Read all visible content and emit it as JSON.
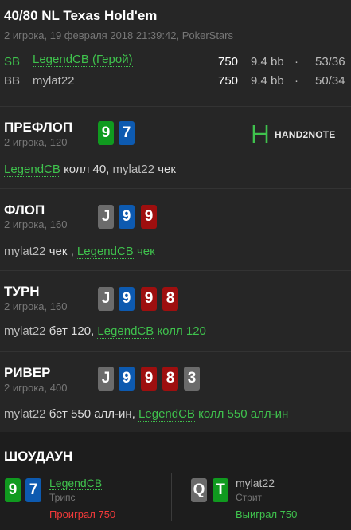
{
  "header": {
    "title": "40/80 NL Texas Hold'em",
    "subtitle": "2 игрока, 19 февраля 2018 21:39:42, PokerStars"
  },
  "players": [
    {
      "position": "SB",
      "name": "LegendCB (Герой)",
      "stack": "750",
      "bb": "9.4 bb",
      "dot": "·",
      "stats": "53/36"
    },
    {
      "position": "BB",
      "name": "mylat22",
      "stack": "750",
      "bb": "9.4 bb",
      "dot": "·",
      "stats": "50/34"
    }
  ],
  "logo": {
    "text": "HAND2NOTE"
  },
  "streets": {
    "preflop": {
      "title": "ПРЕФЛОП",
      "sub": "2 игрока, 120",
      "cards": [
        "9",
        "7"
      ],
      "actions": {
        "p1": "LegendCB",
        "a1": " колл 40, ",
        "p2": "mylat22",
        "a2": " чек"
      }
    },
    "flop": {
      "title": "ФЛОП",
      "sub": "2 игрока, 160",
      "cards": [
        "J",
        "9",
        "9"
      ],
      "actions": {
        "p1": "mylat22",
        "a1": " чек , ",
        "p2": "LegendCB",
        "a2": " чек"
      }
    },
    "turn": {
      "title": "ТУРН",
      "sub": "2 игрока, 160",
      "cards": [
        "J",
        "9",
        "9",
        "8"
      ],
      "actions": {
        "p1": "mylat22",
        "a1": " бет 120, ",
        "p2": "LegendCB",
        "a2": " колл 120"
      }
    },
    "river": {
      "title": "РИВЕР",
      "sub": "2 игрока, 400",
      "cards": [
        "J",
        "9",
        "9",
        "8",
        "3"
      ],
      "actions": {
        "p1": "mylat22",
        "a1": " бет 550 алл-ин, ",
        "p2": "LegendCB",
        "a2": " колл 550 алл-ин"
      }
    }
  },
  "showdown": {
    "title": "ШОУДАУН",
    "left": {
      "cards": [
        "9",
        "7"
      ],
      "name": "LegendCB",
      "hand": "Трипс",
      "result": "Проиграл 750"
    },
    "right": {
      "cards": [
        "Q",
        "T"
      ],
      "name": "mylat22",
      "hand": "Стрит",
      "result": "Выиграл 750"
    }
  },
  "colors": {
    "green_card": "#109a1f",
    "blue_card": "#0d5ab0",
    "red_card": "#9e0f0f",
    "gray_card": "#6b6b6b",
    "player_link": "#3fc24d",
    "loss": "#f23a3a"
  }
}
